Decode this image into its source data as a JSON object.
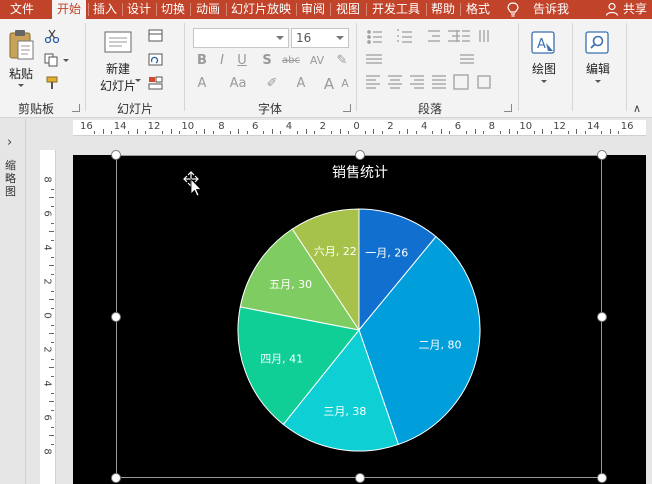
{
  "tabs": [
    {
      "label": "文件",
      "active": false
    },
    {
      "label": "开始",
      "active": true
    },
    {
      "label": "插入",
      "active": false
    },
    {
      "label": "设计",
      "active": false
    },
    {
      "label": "切换",
      "active": false
    },
    {
      "label": "动画",
      "active": false
    },
    {
      "label": "幻灯片放映",
      "active": false
    },
    {
      "label": "审阅",
      "active": false
    },
    {
      "label": "视图",
      "active": false
    },
    {
      "label": "开发工具",
      "active": false
    },
    {
      "label": "帮助",
      "active": false
    },
    {
      "label": "格式",
      "active": false
    }
  ],
  "tell_me": "告诉我",
  "share": "共享",
  "groups": {
    "clipboard": {
      "label": "剪贴板",
      "paste": "粘贴"
    },
    "slides": {
      "label": "幻灯片",
      "new_slide_1": "新建",
      "new_slide_2": "幻灯片"
    },
    "font": {
      "label": "字体",
      "font_name": "",
      "font_size": "16"
    },
    "paragraph": {
      "label": "段落"
    },
    "drawing": {
      "label": "绘图"
    },
    "editing": {
      "label": "编辑"
    }
  },
  "thumbnail_pane_label": "缩略图",
  "ruler": {
    "h_labels": [
      "16",
      "14",
      "12",
      "10",
      "8",
      "6",
      "4",
      "2",
      "0",
      "2",
      "4",
      "6",
      "8",
      "10",
      "12",
      "14",
      "16"
    ],
    "v_labels": [
      "8",
      "6",
      "4",
      "2",
      "0",
      "2",
      "4",
      "6",
      "8"
    ]
  },
  "chart_data": {
    "type": "pie",
    "title": "销售统计",
    "categories": [
      "一月",
      "二月",
      "三月",
      "四月",
      "五月",
      "六月"
    ],
    "values": [
      26,
      80,
      38,
      41,
      30,
      22
    ],
    "colors": [
      "#1170cf",
      "#009edb",
      "#0ecfd4",
      "#10cf96",
      "#7fcd62",
      "#a6c24a"
    ],
    "data_labels": [
      "一月, 26",
      "二月, 80",
      "三月, 38",
      "四月, 41",
      "五月, 30",
      "六月, 22"
    ],
    "start_angle_deg": 0,
    "direction": "clockwise",
    "legend": "none"
  }
}
